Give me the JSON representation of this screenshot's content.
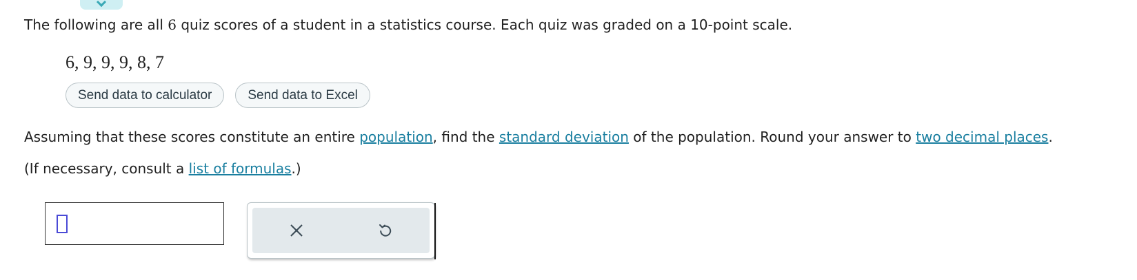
{
  "question": {
    "part1": "The following are all ",
    "count": "6",
    "part2": " quiz scores of a student in a statistics course. Each quiz was graded on a 10-point scale."
  },
  "data_values": "6, 9, 9, 9, 8, 7",
  "buttons": {
    "calculator": "Send data to calculator",
    "excel": "Send data to Excel"
  },
  "prompt": {
    "part1": "Assuming that these scores constitute an entire ",
    "link_population": "population",
    "part2": ", find the ",
    "link_sd": "standard deviation",
    "part3": " of the population. Round your answer to ",
    "link_decimals": "two decimal places",
    "part4": "."
  },
  "prompt2": {
    "part1": "(If necessary, consult a ",
    "link_formulas": "list of formulas",
    "part2": ".)"
  },
  "answer": {
    "value": ""
  },
  "icons": {
    "clear": "close-icon",
    "undo": "undo-icon"
  },
  "colors": {
    "link": "#1a7fa0",
    "tab": "#cfeff3",
    "cursor": "#4a4ad6"
  }
}
